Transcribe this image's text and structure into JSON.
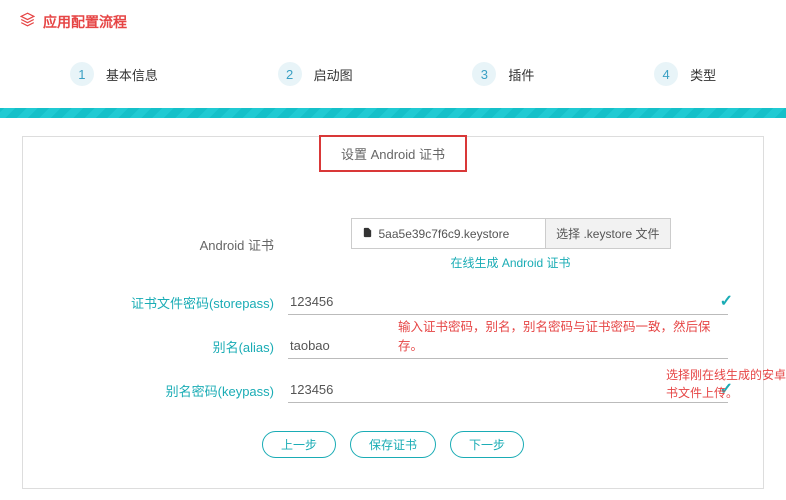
{
  "header": {
    "title": "应用配置流程"
  },
  "steps": [
    {
      "num": "1",
      "label": "基本信息"
    },
    {
      "num": "2",
      "label": "启动图"
    },
    {
      "num": "3",
      "label": "插件"
    },
    {
      "num": "4",
      "label": "类型"
    }
  ],
  "tab": {
    "label": "设置 Android 证书"
  },
  "form": {
    "cert_label": "Android 证书",
    "file_name": "5aa5e39c7f6c9.keystore",
    "choose_btn": "选择 .keystore 文件",
    "gen_link": "在线生成 Android 证书",
    "storepass_label": "证书文件密码(storepass)",
    "storepass_value": "123456",
    "alias_label": "别名(alias)",
    "alias_value": "taobao",
    "keypass_label": "别名密码(keypass)",
    "keypass_value": "123456"
  },
  "annotations": {
    "right": "选择刚在线生成的安卓证书文件上传。",
    "middle": "输入证书密码，别名，别名密码与证书密码一致，然后保存。"
  },
  "buttons": {
    "prev": "上一步",
    "save": "保存证书",
    "next": "下一步"
  }
}
